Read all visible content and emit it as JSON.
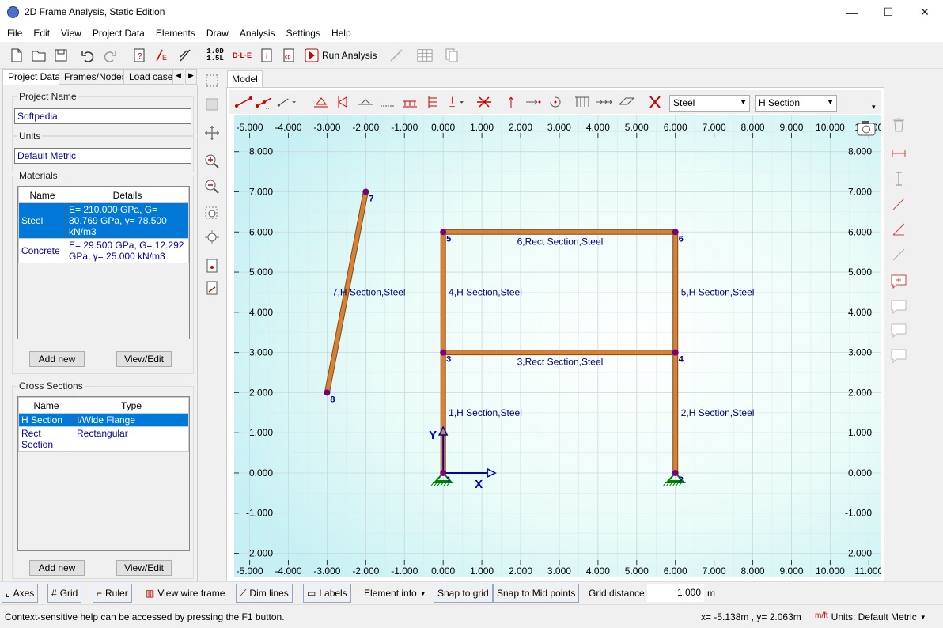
{
  "window": {
    "title": "2D Frame Analysis, Static Edition",
    "minimize": "—",
    "maximize": "☐",
    "close": "✕"
  },
  "menu": [
    "File",
    "Edit",
    "View",
    "Project Data",
    "Elements",
    "Draw",
    "Analysis",
    "Settings",
    "Help"
  ],
  "toolbar": {
    "load_combo_top": "1.0D",
    "load_combo_bottom": "1.5L",
    "dle": "D·L·E",
    "run_analysis": "Run Analysis"
  },
  "left_tabs": [
    "Project Data",
    "Frames/Nodes",
    "Load cases"
  ],
  "project": {
    "name_label": "Project Name",
    "name_value": "Softpedia",
    "units_label": "Units",
    "units_value": "Default Metric"
  },
  "materials": {
    "title": "Materials",
    "headers": [
      "Name",
      "Details"
    ],
    "rows": [
      {
        "name": "Steel",
        "details": "E= 210.000 GPa, G= 80.769 GPa, γ= 78.500 kN/m3"
      },
      {
        "name": "Concrete",
        "details": "E= 29.500 GPa, G= 12.292 GPa, γ= 25.000 kN/m3"
      }
    ],
    "add_new": "Add new",
    "view_edit": "View/Edit"
  },
  "cross_sections": {
    "title": "Cross Sections",
    "headers": [
      "Name",
      "Type"
    ],
    "rows": [
      {
        "name": "H Section",
        "type": "I/Wide Flange"
      },
      {
        "name": "Rect Section",
        "type": "Rectangular"
      }
    ],
    "add_new": "Add new",
    "view_edit": "View/Edit"
  },
  "model_tab": "Model",
  "draw_toolbar": {
    "material": "Steel",
    "section": "H Section"
  },
  "chart_data": {
    "type": "scatter",
    "x_ticks": [
      "-5.000",
      "-4.000",
      "-3.000",
      "-2.000",
      "-1.000",
      "0.000",
      "1.000",
      "2.000",
      "3.000",
      "4.000",
      "5.000",
      "6.000",
      "7.000",
      "8.000",
      "9.000",
      "10.000",
      "11.000"
    ],
    "y_ticks": [
      "8.000",
      "7.000",
      "6.000",
      "5.000",
      "4.000",
      "3.000",
      "2.000",
      "1.000",
      "0.000",
      "-1.000",
      "-2.000"
    ],
    "xlim": [
      -5.4,
      11.3
    ],
    "ylim": [
      -2.6,
      8.9
    ],
    "axis_x_label": "X",
    "axis_y_label": "Y",
    "nodes": [
      {
        "id": "1",
        "x": 0,
        "y": 0
      },
      {
        "id": "2",
        "x": 6,
        "y": 0
      },
      {
        "id": "3",
        "x": 0,
        "y": 3
      },
      {
        "id": "4",
        "x": 6,
        "y": 3
      },
      {
        "id": "5",
        "x": 0,
        "y": 6
      },
      {
        "id": "6",
        "x": 6,
        "y": 6
      },
      {
        "id": "7",
        "x": -2,
        "y": 7
      },
      {
        "id": "8",
        "x": -3,
        "y": 2
      }
    ],
    "frames": [
      {
        "from": "1",
        "to": "3",
        "label": "1,H Section,Steel"
      },
      {
        "from": "2",
        "to": "4",
        "label": "2,H Section,Steel"
      },
      {
        "from": "3",
        "to": "4",
        "label": "3,Rect Section,Steel"
      },
      {
        "from": "3",
        "to": "5",
        "label": "4,H Section,Steel"
      },
      {
        "from": "4",
        "to": "6",
        "label": "5,H Section,Steel"
      },
      {
        "from": "5",
        "to": "6",
        "label": "6,Rect Section,Steel"
      },
      {
        "from": "8",
        "to": "7",
        "label": "7,H Section,Steel"
      }
    ],
    "supports": [
      "1",
      "2"
    ],
    "colors": {
      "frame": "#d2823a",
      "node": "#7a007a",
      "label": "#000080",
      "support": "#008000",
      "axis": "#0000c0"
    }
  },
  "bottom_bar": {
    "axes": "Axes",
    "grid": "Grid",
    "ruler": "Ruler",
    "wire": "View wire frame",
    "dim": "Dim lines",
    "labels": "Labels",
    "element_info": "Element info",
    "snap_grid": "Snap to grid",
    "snap_mid": "Snap to Mid points",
    "grid_distance_label": "Grid distance",
    "grid_distance_value": "1.000",
    "grid_unit": "m"
  },
  "status": {
    "help": "Context-sensitive help can be accessed by pressing the F1 button.",
    "coords": "x= -5.138m , y= 2.063m",
    "units": "Units: Default Metric"
  }
}
